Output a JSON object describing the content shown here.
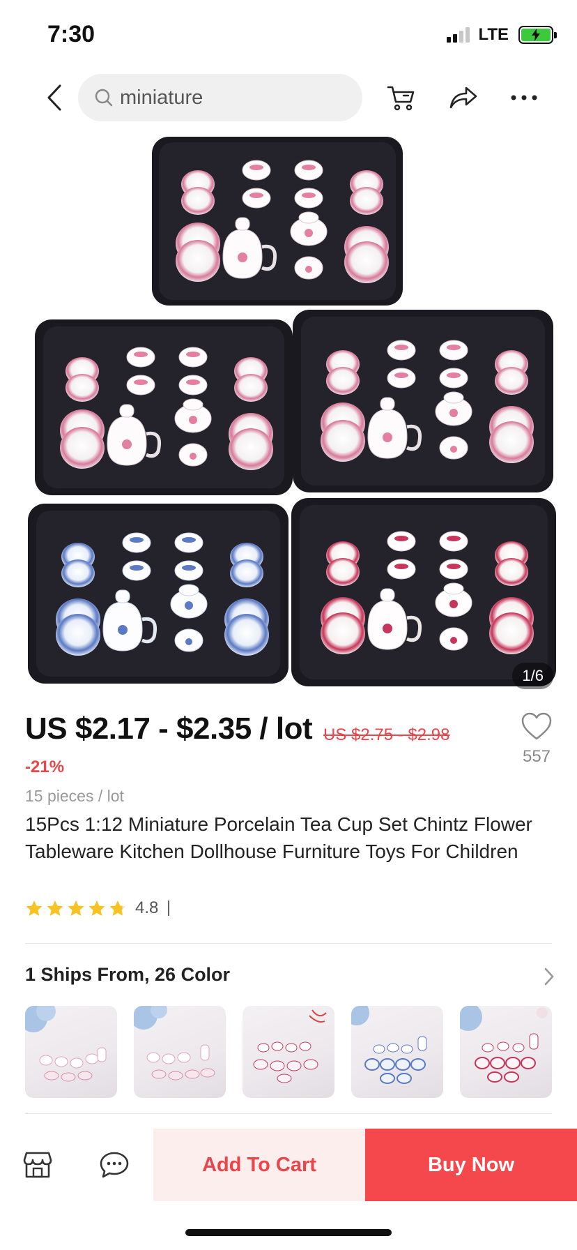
{
  "status_bar": {
    "time": "7:30",
    "network": "LTE",
    "battery": "charging"
  },
  "nav": {
    "search_text": "miniature",
    "icons": [
      "back-icon",
      "search-icon",
      "cart-icon",
      "share-icon",
      "more-icon"
    ]
  },
  "gallery": {
    "indicator": "1/6",
    "current_index": 1,
    "total": 6
  },
  "product": {
    "price": "US $2.17 - $2.35 / lot",
    "original_price": "US $2.75 - $2.98",
    "discount": "-21%",
    "wishlist_count": "557",
    "unit": "15 pieces / lot",
    "title": "15Pcs 1:12 Miniature Porcelain Tea Cup Set Chintz Flower Tableware Kitchen Dollhouse Furniture Toys For Children",
    "rating": "4.8",
    "stars_value": 4.8
  },
  "variants": {
    "title": "1 Ships From, 26 Color"
  },
  "bottom_bar": {
    "add_to_cart": "Add To Cart",
    "buy_now": "Buy Now",
    "icons": [
      "store-icon",
      "chat-icon"
    ]
  },
  "colors": {
    "accent_red": "#f4484c",
    "accent_red_light": "#fdeeee",
    "text_dark": "#222222",
    "star_yellow": "#f8c322"
  }
}
